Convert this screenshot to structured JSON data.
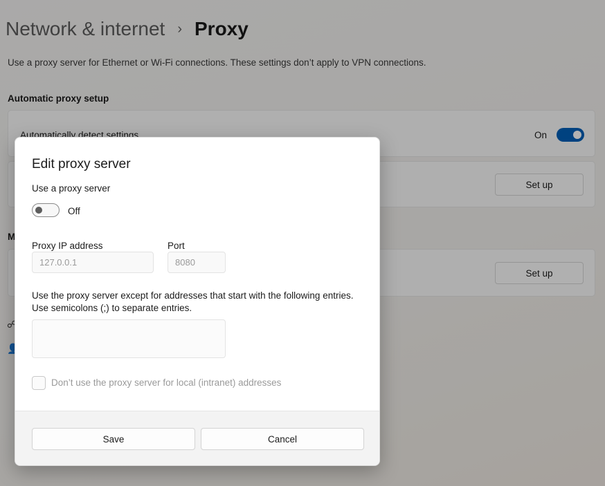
{
  "breadcrumb": {
    "parent": "Network & internet",
    "separator": "›",
    "current": "Proxy"
  },
  "page": {
    "description": "Use a proxy server for Ethernet or Wi-Fi connections. These settings don’t apply to VPN connections.",
    "automatic_section_title": "Automatic proxy setup",
    "auto_detect_label": "Automatically detect settings",
    "auto_detect_state": "On",
    "setup_button_1": "Set up",
    "manual_section_title_partial": "M",
    "setup_button_2": "Set up"
  },
  "dialog": {
    "title": "Edit proxy server",
    "use_proxy_label": "Use a proxy server",
    "use_proxy_state": "Off",
    "ip_label": "Proxy IP address",
    "ip_placeholder": "127.0.0.1",
    "port_label": "Port",
    "port_placeholder": "8080",
    "exceptions_text_line1": "Use the proxy server except for addresses that start with the following entries.",
    "exceptions_text_line2": "Use semicolons (;) to separate entries.",
    "exceptions_value": "",
    "local_checkbox_label": "Don’t use the proxy server for local (intranet) addresses",
    "save_label": "Save",
    "cancel_label": "Cancel"
  },
  "colors": {
    "accent": "#005fb8",
    "dialog_background": "#ffffff",
    "footer_background": "#f3f3f3"
  }
}
